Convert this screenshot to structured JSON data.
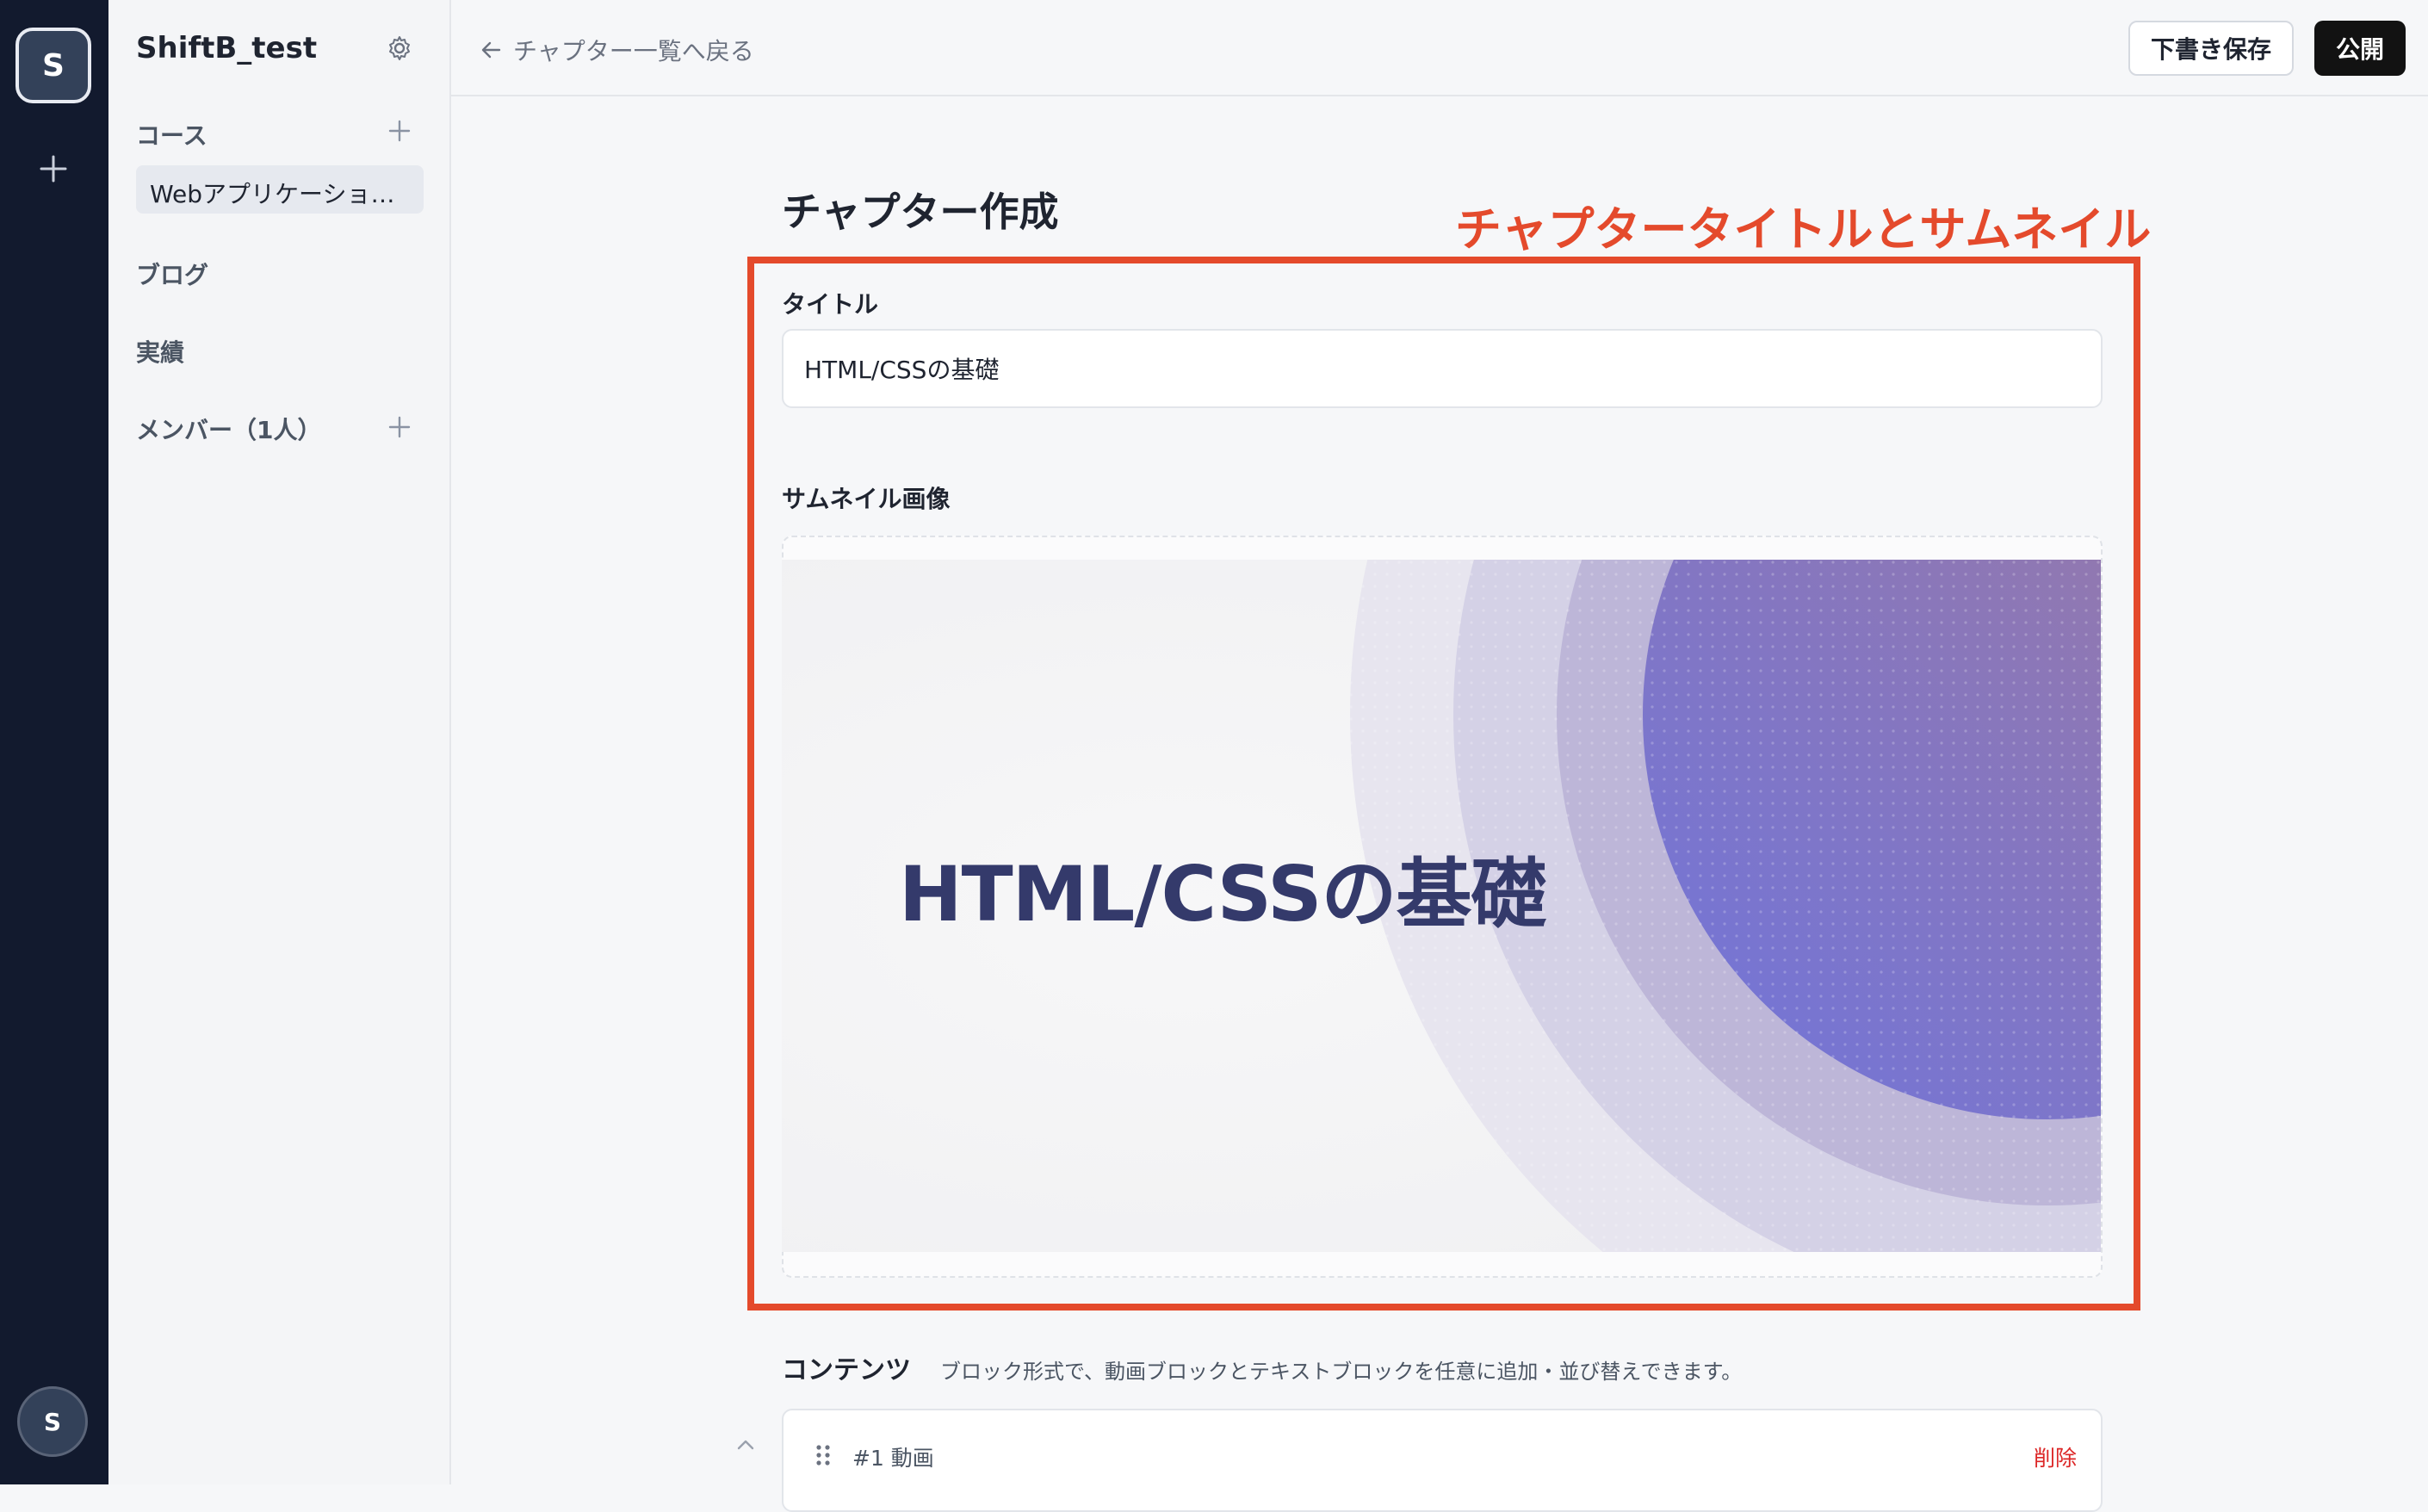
{
  "rail": {
    "workspace_initial": "S",
    "user_initial": "S",
    "icons": [
      "plus-icon"
    ]
  },
  "sidebar": {
    "workspace_name": "ShiftB_test",
    "courses_label": "コース",
    "course_items": [
      "Webアプリケーショ…"
    ],
    "blog_label": "ブログ",
    "achievements_label": "実績",
    "members_label": "メンバー（1人）"
  },
  "topbar": {
    "back_label": "チャプター一覧へ戻る",
    "draft_label": "下書き保存",
    "publish_label": "公開"
  },
  "main": {
    "page_title": "チャプター作成",
    "annotation": "チャプタータイトルとサムネイル",
    "title_label": "タイトル",
    "title_value": "HTML/CSSの基礎",
    "thumbnail_label": "サムネイル画像",
    "thumbnail_text": "HTML/CSSの基礎",
    "contents_title": "コンテンツ",
    "contents_description": "ブロック形式で、動画ブロックとテキストブロックを任意に追加・並び替えできます。",
    "blocks": [
      {
        "label": "#1 動画",
        "delete_label": "削除"
      }
    ]
  },
  "colors": {
    "rail_bg": "#121a2e",
    "accent_annotation": "#e44a2c",
    "delete_red": "#dc2626",
    "publish_bg": "#121212",
    "thumbnail_text": "#343a6b"
  }
}
